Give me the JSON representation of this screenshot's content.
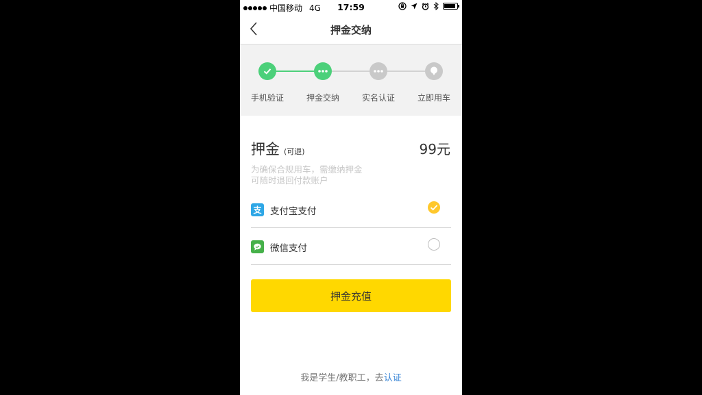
{
  "status_bar": {
    "carrier": "中国移动",
    "network": "4G",
    "time": "17:59"
  },
  "nav": {
    "title": "押金交纳"
  },
  "steps": [
    {
      "label": "手机验证",
      "state": "done"
    },
    {
      "label": "押金交纳",
      "state": "current"
    },
    {
      "label": "实名认证",
      "state": "pending"
    },
    {
      "label": "立即用车",
      "state": "pending"
    }
  ],
  "deposit": {
    "title": "押金",
    "subtitle": "(可退)",
    "amount": "99元",
    "desc_line1": "为确保合规用车，需缴纳押金",
    "desc_line2": "可随时退回付款账户"
  },
  "payment": {
    "alipay_label": "支付宝支付",
    "alipay_icon": "alipay-icon",
    "wechat_label": "微信支付",
    "wechat_icon": "wechat-icon",
    "selected": "alipay"
  },
  "submit_label": "押金充值",
  "footer": {
    "text": "我是学生/教职工，去",
    "link": "认证"
  },
  "colors": {
    "step_done": "#4cd07a",
    "step_pending": "#c9c9c9",
    "accent_yellow": "#ffd800",
    "radio_checked": "#ffc82c",
    "link": "#3a86d6",
    "alipay": "#2fa7e6",
    "wechat": "#46b14a"
  }
}
